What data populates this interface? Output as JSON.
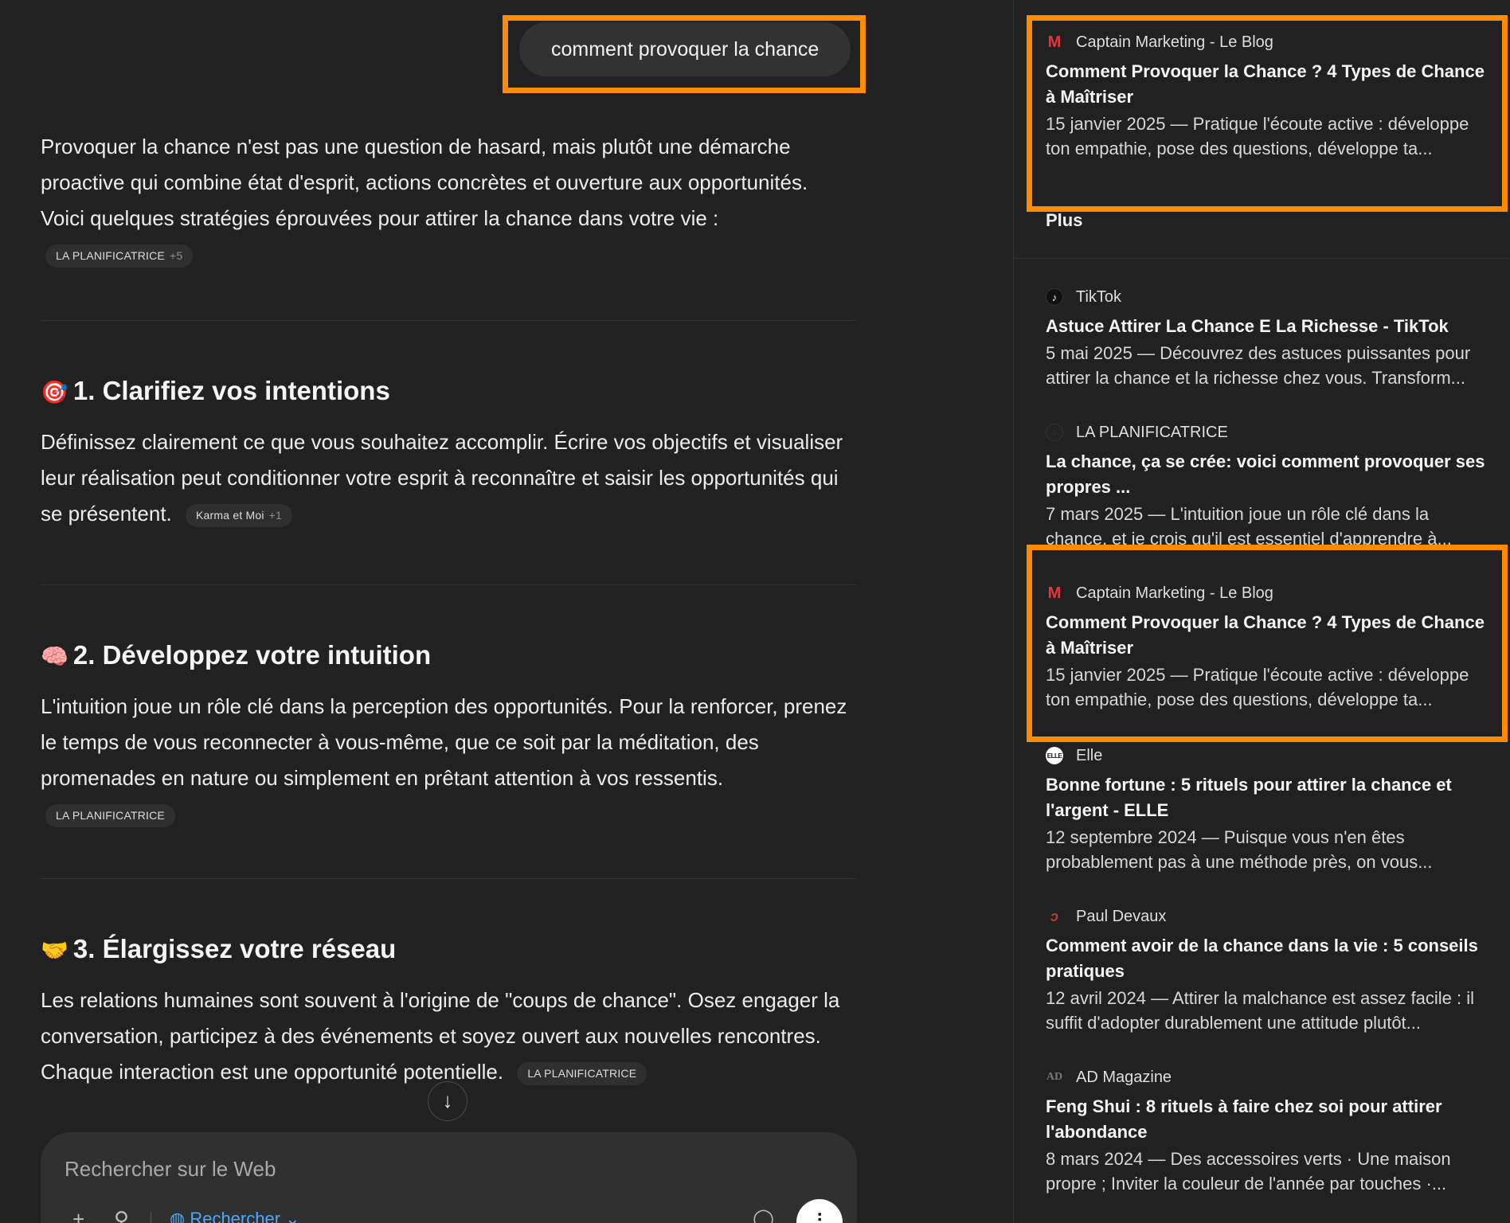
{
  "conversation": {
    "query": "comment provoquer la chance",
    "intro": "Provoquer la chance n'est pas une question de hasard, mais plutôt une démarche proactive qui combine état d'esprit, actions concrètes et ouverture aux opportunités. Voici quelques stratégies éprouvées pour attirer la chance dans votre vie :",
    "intro_chip": {
      "label": "LA PLANIFICATRICE",
      "more": "+5"
    },
    "sections": [
      {
        "emoji": "🎯",
        "title": "1. Clarifiez vos intentions",
        "text": "Définissez clairement ce que vous souhaitez accomplir. Écrire vos objectifs et visualiser leur réalisation peut conditionner votre esprit à reconnaître et saisir les opportunités qui se présentent.",
        "chip": {
          "label": "Karma et Moi",
          "more": "+1"
        }
      },
      {
        "emoji": "🧠",
        "title": "2. Développez votre intuition",
        "text": "L'intuition joue un rôle clé dans la perception des opportunités. Pour la renforcer, prenez le temps de vous reconnecter à vous-même, que ce soit par la méditation, des promenades en nature ou simplement en prêtant attention à vos ressentis.",
        "chip": {
          "label": "LA PLANIFICATRICE",
          "more": ""
        }
      },
      {
        "emoji": "🤝",
        "title": "3. Élargissez votre réseau",
        "text": "Les relations humaines sont souvent à l'origine de \"coups de chance\". Osez engager la conversation, participez à des événements et soyez ouvert aux nouvelles rencontres. Chaque interaction est une opportunité potentielle.",
        "chip": {
          "label": "LA PLANIFICATRICE",
          "more": ""
        }
      }
    ]
  },
  "composer": {
    "placeholder": "Rechercher sur le Web",
    "search_label": "Rechercher",
    "plus_icon": "+",
    "settings_icon": "⚲"
  },
  "sources": {
    "more_label": "Plus",
    "items": [
      {
        "site": "Captain Marketing - Le Blog",
        "title": "Comment Provoquer la Chance ? 4 Types de Chance à Maîtriser",
        "snippet": "15 janvier 2025 — Pratique l'écoute active : développe ton empathie, pose des questions, développe ta..."
      },
      {
        "site": "TikTok",
        "title": "Astuce Attirer La Chance E La Richesse - TikTok",
        "snippet": "5 mai 2025 — Découvrez des astuces puissantes pour attirer la chance et la richesse chez vous. Transform..."
      },
      {
        "site": "LA PLANIFICATRICE",
        "title": "La chance, ça se crée: voici comment provoquer ses propres ...",
        "snippet": "7 mars 2025 — L'intuition joue un rôle clé dans la chance, et je crois qu'il est essentiel d'apprendre à..."
      },
      {
        "site": "Captain Marketing - Le Blog",
        "title": "Comment Provoquer la Chance ? 4 Types de Chance à Maîtriser",
        "snippet": "15 janvier 2025 — Pratique l'écoute active : développe ton empathie, pose des questions, développe ta..."
      },
      {
        "site": "Elle",
        "title": "Bonne fortune : 5 rituels pour attirer la chance et l'argent - ELLE",
        "snippet": "12 septembre 2024 — Puisque vous n'en êtes probablement pas à une méthode près, on vous..."
      },
      {
        "site": "Paul Devaux",
        "title": "Comment avoir de la chance dans la vie : 5 conseils pratiques",
        "snippet": "12 avril 2024 — Attirer la malchance est assez facile : il suffit d'adopter durablement une attitude plutôt..."
      },
      {
        "site": "AD Magazine",
        "title": "Feng Shui : 8 rituels à faire chez soi pour attirer l'abondance",
        "snippet": "8 mars 2024 — Des accessoires verts · Une maison propre ; Inviter la couleur de l'année par touches ·..."
      }
    ]
  },
  "colors": {
    "background": "#212121",
    "highlight": "#ff8c00",
    "link_blue": "#48aaff"
  }
}
